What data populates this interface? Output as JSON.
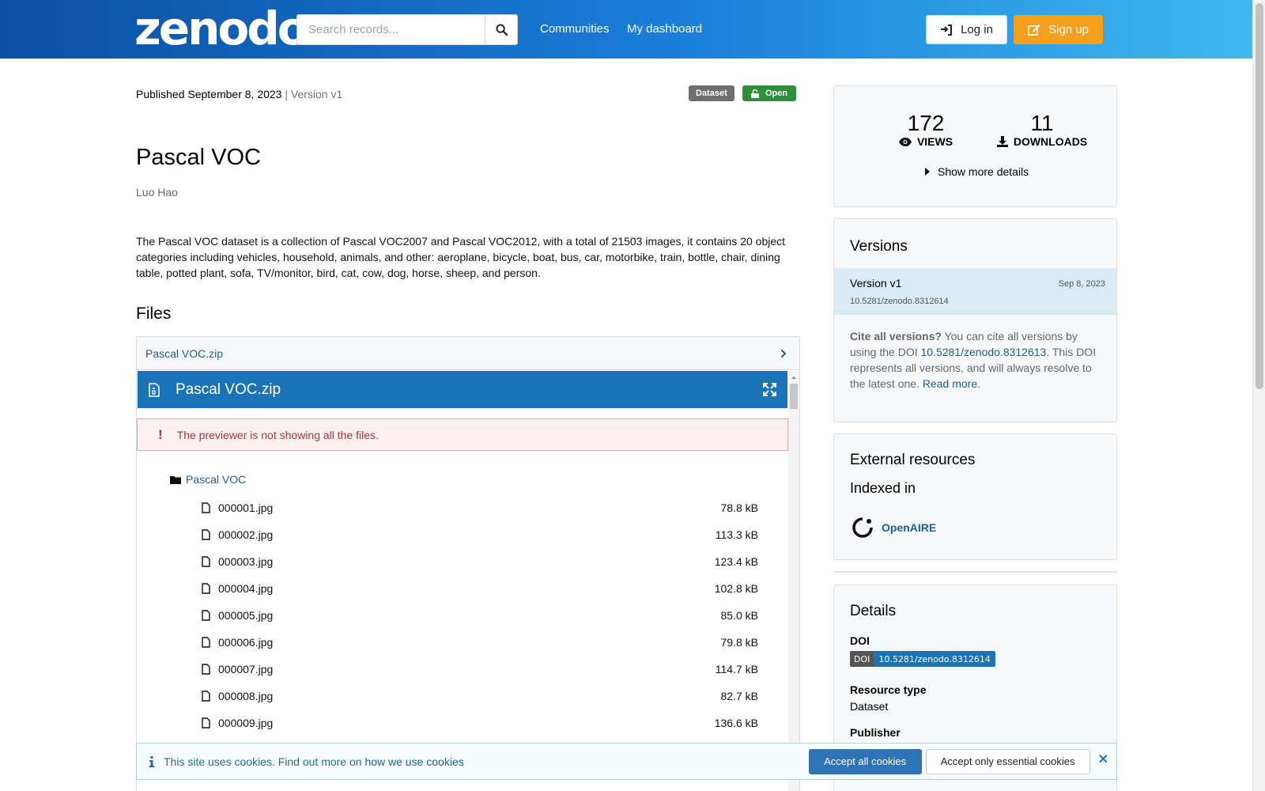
{
  "header": {
    "logo": "zenodo",
    "search_placeholder": "Search records...",
    "nav": [
      "Communities",
      "My dashboard"
    ],
    "login_label": "Log in",
    "signup_label": "Sign up"
  },
  "record": {
    "published": "Published September 8, 2023",
    "version_sep": " | ",
    "version": "Version v1",
    "badge_type": "Dataset",
    "badge_access": "Open",
    "title": "Pascal VOC",
    "author": "Luo Hao",
    "description": "The Pascal VOC dataset is a collection of Pascal VOC2007 and Pascal VOC2012, with a total of 21503 images, it contains 20 object categories including vehicles, household, animals, and other: aeroplane, bicycle, boat, bus, car, motorbike, train, bottle, chair, dining table, potted plant, sofa, TV/monitor, bird, cat, cow, dog, horse, sheep, and person."
  },
  "files": {
    "heading": "Files",
    "accordion_label": "Pascal VOC.zip",
    "preview_title": "Pascal VOC.zip",
    "warning": "The previewer is not showing all the files.",
    "folder": "Pascal VOC",
    "items": [
      {
        "name": "000001.jpg",
        "size": "78.8 kB"
      },
      {
        "name": "000002.jpg",
        "size": "113.3 kB"
      },
      {
        "name": "000003.jpg",
        "size": "123.4 kB"
      },
      {
        "name": "000004.jpg",
        "size": "102.8 kB"
      },
      {
        "name": "000005.jpg",
        "size": "85.0 kB"
      },
      {
        "name": "000006.jpg",
        "size": "79.8 kB"
      },
      {
        "name": "000007.jpg",
        "size": "114.7 kB"
      },
      {
        "name": "000008.jpg",
        "size": "82.7 kB"
      },
      {
        "name": "000009.jpg",
        "size": "136.6 kB"
      }
    ]
  },
  "stats": {
    "views": "172",
    "views_label": "VIEWS",
    "downloads": "11",
    "downloads_label": "DOWNLOADS",
    "more": "Show more details"
  },
  "versions": {
    "heading": "Versions",
    "items": [
      {
        "name": "Version v1",
        "date": "Sep 8, 2023",
        "doi": "10.5281/zenodo.8312614"
      }
    ],
    "cite_bold": "Cite all versions?",
    "cite_pre": " You can cite all versions by using the DOI ",
    "cite_doi": "10.5281/zenodo.8312613",
    "cite_post": ". This DOI represents all versions, and will always resolve to the latest one. ",
    "read_more": "Read more",
    "cite_end": "."
  },
  "external": {
    "heading": "External resources",
    "subheading": "Indexed in",
    "openaire": "OpenAIRE"
  },
  "details": {
    "heading": "Details",
    "doi_label": "DOI",
    "doi_badge_left": "DOI",
    "doi_value": "10.5281/zenodo.8312614",
    "resource_type_label": "Resource type",
    "resource_type": "Dataset",
    "publisher_label": "Publisher"
  },
  "cookie": {
    "text": "This site uses cookies. Find out more on ",
    "link": "how we use cookies",
    "accept_all": "Accept all cookies",
    "accept_essential": "Accept only essential cookies"
  },
  "colors": {
    "header_start": "#0b4fa3",
    "header_end": "#3eb8ef",
    "signup": "#f4a01c",
    "open_badge": "#2e8f3a",
    "link": "#1c5f94",
    "preview_bar": "#1b73b8"
  }
}
